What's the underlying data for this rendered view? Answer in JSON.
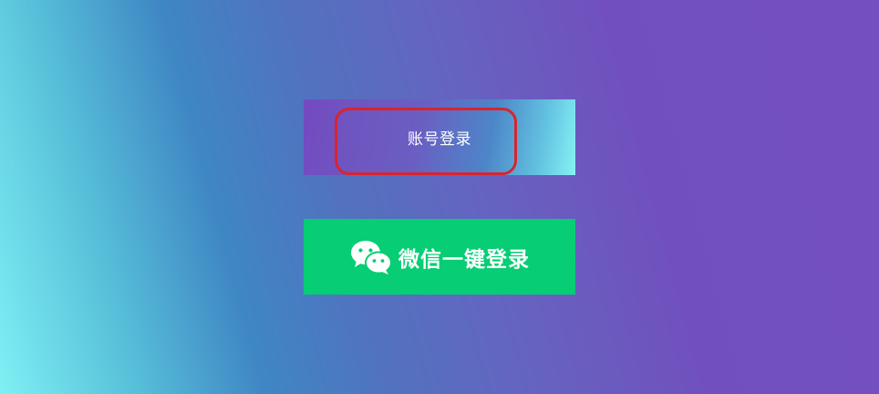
{
  "login": {
    "account_label": "账号登录",
    "wechat_label": "微信一键登录"
  },
  "colors": {
    "wechat_green": "#07cd74",
    "highlight_red": "#d8242f"
  },
  "icons": {
    "wechat": "wechat-icon"
  }
}
